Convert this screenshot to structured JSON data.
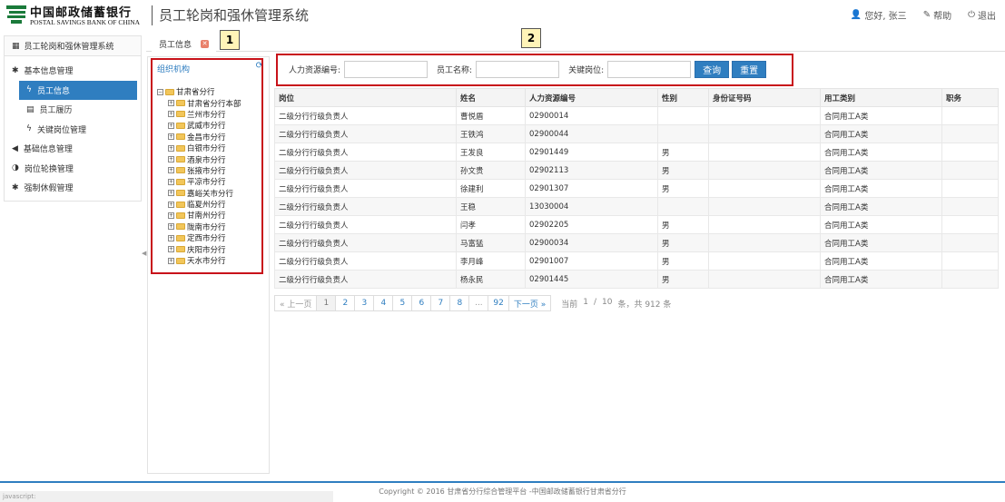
{
  "header": {
    "logo_cn": "中国邮政储蓄银行",
    "logo_en": "POSTAL SAVINGS BANK OF CHINA",
    "app_title": "员工轮岗和强休管理系统",
    "greeting": "您好, 张三",
    "help": "帮助",
    "logout": "退出"
  },
  "sidebar": {
    "title": "员工轮岗和强休管理系统",
    "items": [
      {
        "label": "基本信息管理",
        "icon": "asterisk-icon"
      },
      {
        "label": "员工信息",
        "icon": "bolt-icon",
        "active": true
      },
      {
        "label": "员工履历",
        "icon": "book-icon"
      },
      {
        "label": "关键岗位管理",
        "icon": "bolt-icon"
      },
      {
        "label": "基础信息管理",
        "icon": "bullhorn-icon"
      },
      {
        "label": "岗位轮换管理",
        "icon": "half-circle-icon"
      },
      {
        "label": "强制休假管理",
        "icon": "asterisk-icon"
      }
    ]
  },
  "tab": {
    "label": "员工信息"
  },
  "org": {
    "title": "组织机构",
    "root": "甘肃省分行",
    "children": [
      "甘肃省分行本部",
      "兰州市分行",
      "武威市分行",
      "金昌市分行",
      "白银市分行",
      "酒泉市分行",
      "张掖市分行",
      "平凉市分行",
      "嘉峪关市分行",
      "临夏州分行",
      "甘南州分行",
      "陇南市分行",
      "定西市分行",
      "庆阳市分行",
      "天水市分行"
    ]
  },
  "search": {
    "hr_label": "人力资源编号:",
    "name_label": "员工名称:",
    "post_label": "关键岗位:",
    "hr_value": "",
    "name_value": "",
    "post_value": "",
    "query_btn": "查询",
    "reset_btn": "重置"
  },
  "table": {
    "columns": [
      "岗位",
      "姓名",
      "人力资源编号",
      "性别",
      "身份证号码",
      "用工类别",
      "职务"
    ],
    "rows": [
      [
        "二级分行行级负责人",
        "曹悦盾",
        "02900014",
        "",
        "",
        "合同用工A类",
        ""
      ],
      [
        "二级分行行级负责人",
        "王铁鸿",
        "02900044",
        "",
        "",
        "合同用工A类",
        ""
      ],
      [
        "二级分行行级负责人",
        "王发良",
        "02901449",
        "男",
        "",
        "合同用工A类",
        ""
      ],
      [
        "二级分行行级负责人",
        "孙文贵",
        "02902113",
        "男",
        "",
        "合同用工A类",
        ""
      ],
      [
        "二级分行行级负责人",
        "徐建利",
        "02901307",
        "男",
        "",
        "合同用工A类",
        ""
      ],
      [
        "二级分行行级负责人",
        "王稳",
        "13030004",
        "",
        "",
        "合同用工A类",
        ""
      ],
      [
        "二级分行行级负责人",
        "闫孝",
        "02902205",
        "男",
        "",
        "合同用工A类",
        ""
      ],
      [
        "二级分行行级负责人",
        "马富猛",
        "02900034",
        "男",
        "",
        "合同用工A类",
        ""
      ],
      [
        "二级分行行级负责人",
        "李月峰",
        "02901007",
        "男",
        "",
        "合同用工A类",
        ""
      ],
      [
        "二级分行行级负责人",
        "杨永民",
        "02901445",
        "男",
        "",
        "合同用工A类",
        ""
      ]
    ]
  },
  "pager": {
    "prev": "« 上一页",
    "pages": [
      "1",
      "2",
      "3",
      "4",
      "5",
      "6",
      "7",
      "8",
      "...",
      "92"
    ],
    "next": "下一页 »",
    "info_prefix": "当前",
    "current": "1",
    "slash": "/",
    "total_pages": "10",
    "info_suffix": "条，共 912 条"
  },
  "annotations": {
    "box1": "1",
    "box2": "2"
  },
  "footer": {
    "text": "Copyright © 2016 甘肃省分行综合管理平台 -中国邮政储蓄银行甘肃省分行",
    "status": "javascript:"
  },
  "colors": {
    "accent": "#2f7ec0",
    "annotation": "#c8121a",
    "logo_green": "#1a7a3a"
  }
}
